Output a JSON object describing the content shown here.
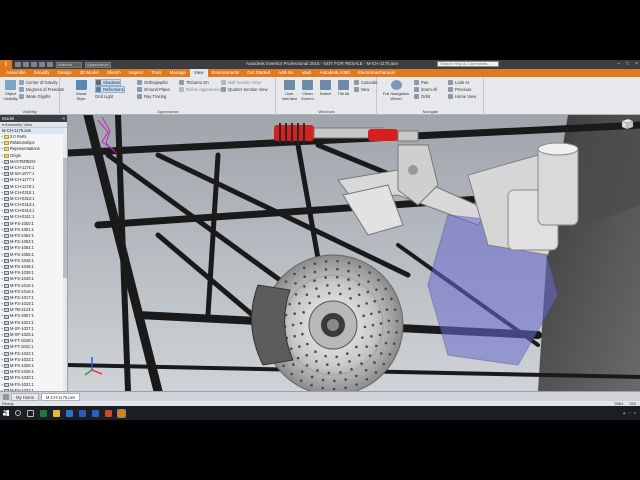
{
  "app": {
    "logo": "I",
    "title": "Autodesk Inventor Professional 2016 - NOT FOR RESALE - M-CH-1175.iam",
    "qat_material": "Material",
    "qat_appearance": "Appearance",
    "search_placeholder": "Search Help & Commands...",
    "win_controls": [
      "–",
      "□",
      "×"
    ]
  },
  "menu_tabs": [
    "Assemble",
    "Simplify",
    "Design",
    "3D Model",
    "Sketch",
    "Inspect",
    "Tools",
    "Manage",
    "View",
    "Environments",
    "Get Started",
    "Add-Ins",
    "Vault",
    "Autodesk A360",
    "Electromechanical"
  ],
  "active_tab": "View",
  "ribbon": {
    "visibility": {
      "label": "Visibility",
      "object_visibility": "Object Visibility",
      "items": [
        "Center of Gravity",
        "Degrees of Freedom",
        "iMate Glyphs"
      ]
    },
    "appearance": {
      "label": "Appearance",
      "visual_style": "Visual Style",
      "items": [
        "Shadows",
        "Reflections",
        "Orthographic",
        "Ground Plane",
        "Ray Tracing",
        "Half Section View",
        "Quarter Section View",
        "TitGamu On",
        "Refine Appearance",
        "Grid Light"
      ]
    },
    "windows": {
      "label": "Windows",
      "user_interface": "User Interface",
      "clean_screen": "Clean Screen",
      "switch": "Switch",
      "tile_all": "Tile All",
      "cascade": "Cascade",
      "new": "New"
    },
    "navigate": {
      "label": "Navigate",
      "full_nav_wheel": "Full Navigation Wheel",
      "items": [
        "Pan",
        "Zoom All",
        "Orbit",
        "Look At",
        "Previous",
        "Home View"
      ]
    }
  },
  "browser": {
    "title": "Model",
    "toolbar": "Assembly View",
    "root": "M-CH-1175.iam",
    "items": [
      "3.0 Parts",
      "Relationships",
      "Representations",
      "Origin",
      "MASTERBOX",
      "M-CH-1176:1",
      "M-SH-1077:1",
      "M-CH-1177:1",
      "M-CH-1178:1",
      "M-CH-0315:1",
      "M-CH-0312:1",
      "M-CH-0313:1",
      "M-CH-0314:1",
      "M-CH-0311:1",
      "M-FS-1050:1",
      "M-FS-1051:1",
      "M-FS-1052:1",
      "M-FS-1053:1",
      "M-FS-1054:1",
      "M-FS-1055:1",
      "M-FS-1046:1",
      "M-FS-1048:1",
      "M-FS-1036:1",
      "M-FS-1040:1",
      "M-FS-1015:1",
      "M-FS-1016:1",
      "M-FS-1017:1",
      "M-FS-1019:1",
      "M-TB-2124:1",
      "M-FS-2067:1",
      "M-FS-1021:1",
      "M-SF-1027:1",
      "M-SF-1028:1",
      "M-FT-1020:1",
      "M-FT-1021:1",
      "M-FS-1022:1",
      "M-FS-1023:1",
      "M-FS-1025:1",
      "M-FS-1026:1",
      "M-FS-1030:1",
      "M-FS-1031:1",
      "M-FS-1032:1"
    ]
  },
  "doc_tabs": [
    "My Home",
    "M-CH-1175.iam"
  ],
  "active_doc": "M-CH-1175.iam",
  "status": {
    "text": "Ready",
    "count1": "3964",
    "count2": "220"
  },
  "colors": {
    "ribbon_accent": "#e07a1f",
    "titlebar": "#3a3f46",
    "coilover_red": "#d62020",
    "frame_tube": "#1a1a1a",
    "upright_blue": "#6a6ad0",
    "caliper": "#5c5c5c"
  },
  "taskbar_icons": [
    "windows-icon",
    "search-icon",
    "task-view-icon",
    "excel-icon",
    "explorer-icon",
    "store-icon",
    "word-icon",
    "outlook-icon",
    "powerpoint-icon",
    "inventor-icon"
  ]
}
